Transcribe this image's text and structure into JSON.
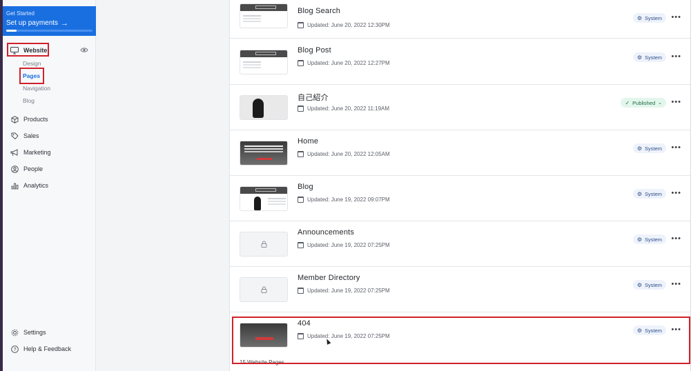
{
  "sidebar": {
    "get_started": {
      "small": "Get Started",
      "big": "Set up payments",
      "arrow": "→",
      "progress": 0.12
    },
    "website": {
      "label": "Website",
      "icon": "monitor-icon"
    },
    "eye_icon": "eye-icon",
    "sub_items": [
      "Design",
      "Pages",
      "Navigation",
      "Blog"
    ],
    "nav": [
      {
        "label": "Products",
        "icon": "box-icon"
      },
      {
        "label": "Sales",
        "icon": "tag-icon"
      },
      {
        "label": "Marketing",
        "icon": "megaphone-icon"
      },
      {
        "label": "People",
        "icon": "person-icon"
      },
      {
        "label": "Analytics",
        "icon": "bar-chart-icon"
      }
    ],
    "footer": [
      {
        "label": "Settings",
        "icon": "gear-icon"
      },
      {
        "label": "Help & Feedback",
        "icon": "help-icon"
      }
    ]
  },
  "pages": [
    {
      "title": "Blog Search",
      "updated": "Updated: June 20, 2022 12:30PM",
      "status": "System",
      "thumb": "doc"
    },
    {
      "title": "Blog Post",
      "updated": "Updated: June 20, 2022 12:27PM",
      "status": "System",
      "thumb": "doc"
    },
    {
      "title": "自己紹介",
      "updated": "Updated: June 20, 2022 11:19AM",
      "status": "Published",
      "thumb": "person"
    },
    {
      "title": "Home",
      "updated": "Updated: June 20, 2022 12:05AM",
      "status": "System",
      "thumb": "dark"
    },
    {
      "title": "Blog",
      "updated": "Updated: June 19, 2022 09:07PM",
      "status": "System",
      "thumb": "doc-person"
    },
    {
      "title": "Announcements",
      "updated": "Updated: June 19, 2022 07:25PM",
      "status": "System",
      "thumb": "lock"
    },
    {
      "title": "Member Directory",
      "updated": "Updated: June 19, 2022 07:25PM",
      "status": "System",
      "thumb": "lock"
    },
    {
      "title": "404",
      "updated": "Updated: June 19, 2022 07:25PM",
      "status": "System",
      "thumb": "dark404"
    }
  ],
  "footer_count": "15 Website Pages",
  "colors": {
    "accent": "#1a6fe0",
    "highlight": "#d0202a",
    "published": "#1d6b43"
  }
}
